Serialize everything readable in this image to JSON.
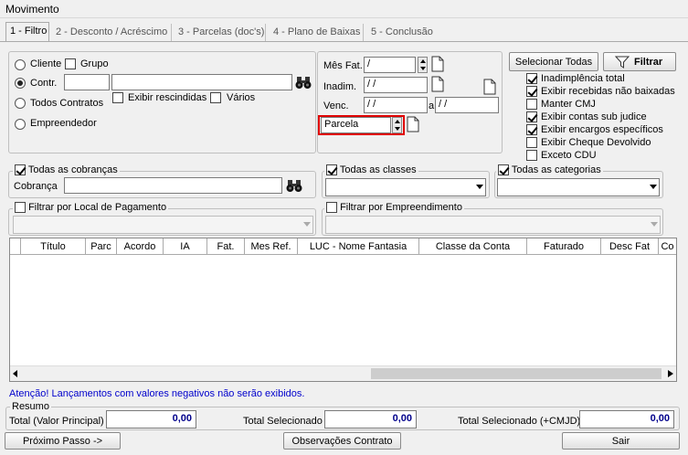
{
  "window": {
    "title": "Movimento"
  },
  "tabs": [
    {
      "label": "1 - Filtro",
      "active": true
    },
    {
      "label": "2 - Desconto / Acréscimo"
    },
    {
      "label": "3 - Parcelas (doc's)"
    },
    {
      "label": "4 - Plano de Baixas"
    },
    {
      "label": "5 - Conclusão"
    }
  ],
  "filter": {
    "cliente": "Cliente",
    "grupo": "Grupo",
    "contr": "Contr.",
    "exibir_rescindidas": "Exibir rescindidas",
    "varios": "Vários",
    "todos_contratos": "Todos Contratos",
    "empreendedor": "Empreendedor"
  },
  "dates": {
    "mes_fat_label": "Mês Fat.",
    "mes_fat_value": "/",
    "inadim_label": "Inadim.",
    "inadim_value": "/ /",
    "venc_label": "Venc.",
    "venc_from": "/ /",
    "venc_sep": "a",
    "venc_to": "/ /",
    "parcela_label": "Parcela"
  },
  "options": {
    "selecionar_todas": "Selecionar Todas",
    "filtrar": "Filtrar",
    "checks": [
      {
        "label": "Inadimplência total",
        "checked": true
      },
      {
        "label": "Exibir recebidas não baixadas",
        "checked": true
      },
      {
        "label": "Manter CMJ",
        "checked": false
      },
      {
        "label": "Exibir contas sub judice",
        "checked": true
      },
      {
        "label": "Exibir encargos específicos",
        "checked": true
      },
      {
        "label": "Exibir Cheque Devolvido",
        "checked": false
      },
      {
        "label": "Exceto CDU",
        "checked": false
      }
    ]
  },
  "groups": {
    "todas_cobrancas": "Todas as cobranças",
    "cobranca_label": "Cobrança",
    "todas_classes": "Todas as classes",
    "todas_categorias": "Todas as categorias",
    "local_pagamento": "Filtrar por Local de Pagamento",
    "empreendimento": "Filtrar por Empreendimento"
  },
  "grid": {
    "columns": [
      "Título",
      "Parc",
      "Acordo",
      "IA",
      "Fat.",
      "Mes Ref.",
      "LUC - Nome Fantasia",
      "Classe da Conta",
      "Faturado",
      "Desc Fat",
      "Co"
    ]
  },
  "warning": "Atenção! Lançamentos com valores negativos não serão exibidos.",
  "resumo": {
    "title": "Resumo",
    "total_principal_label": "Total (Valor Principal)",
    "total_principal": "0,00",
    "total_selecionado_label": "Total Selecionado",
    "total_selecionado": "0,00",
    "total_cmjd_label": "Total Selecionado (+CMJD)",
    "total_cmjd": "0,00"
  },
  "footer": {
    "proximo": "Próximo Passo ->",
    "observacoes": "Observações Contrato",
    "sair": "Sair"
  },
  "colors": {
    "highlight": "#e00000",
    "value_text": "#00008b",
    "warning_text": "#0000cc"
  }
}
